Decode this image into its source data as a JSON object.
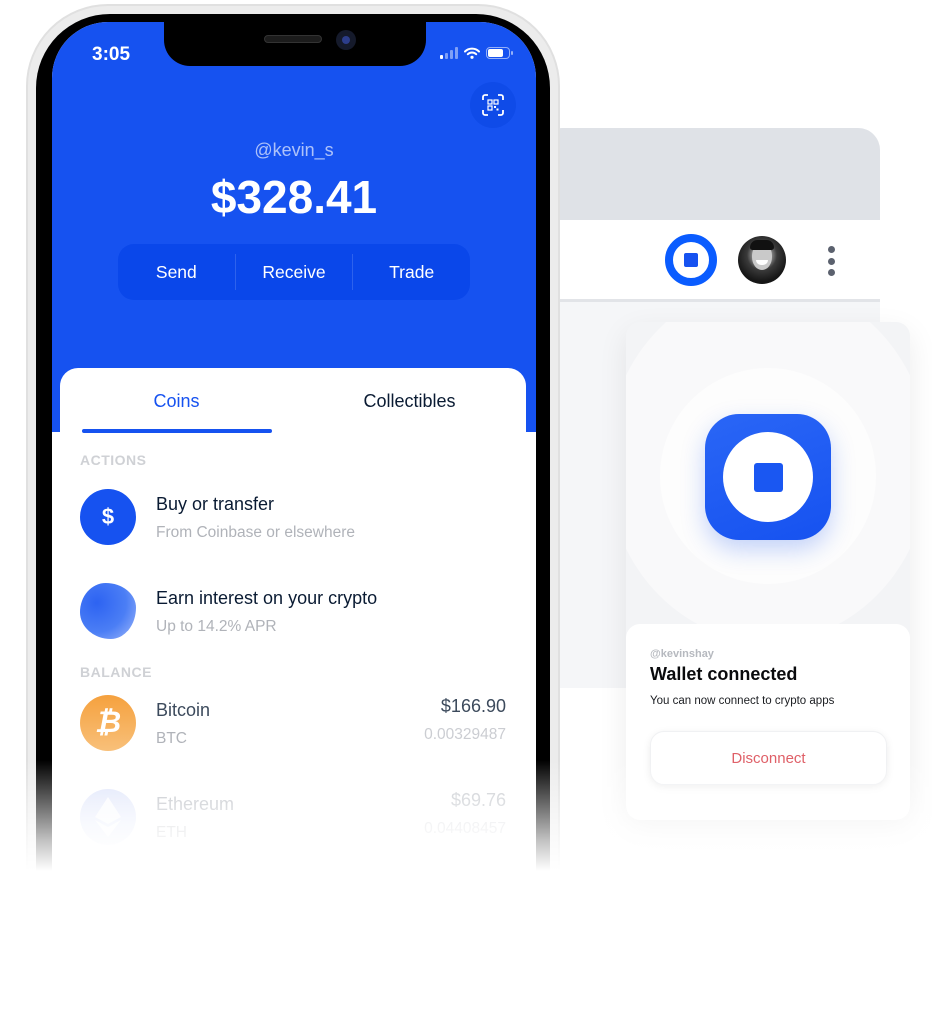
{
  "browser": {
    "extension_icon": "coinbase-wallet-icon",
    "avatar": "user-avatar",
    "menu_icon": "kebab-menu-icon"
  },
  "popup": {
    "logo": "coinbase-wallet-logo",
    "username": "@kevinshay",
    "title": "Wallet connected",
    "subtitle": "You can now connect to crypto apps",
    "disconnect_label": "Disconnect",
    "colors": {
      "brand": "#1652f0",
      "danger": "#df5f67"
    }
  },
  "phone": {
    "status_bar": {
      "time": "3:05",
      "signal_bars": 1,
      "signal_max": 4,
      "battery_level": 0.75
    },
    "header": {
      "qr_icon": "qr-scan-icon",
      "username": "@kevin_s",
      "balance": "$328.41",
      "actions": [
        "Send",
        "Receive",
        "Trade"
      ]
    },
    "tabs": [
      {
        "label": "Coins",
        "active": true
      },
      {
        "label": "Collectibles",
        "active": false
      }
    ],
    "sections": {
      "actions_label": "ACTIONS",
      "balance_label": "BALANCE"
    },
    "action_items": [
      {
        "icon": "dollar-icon",
        "glyph": "$",
        "title": "Buy or transfer",
        "subtitle": "From Coinbase or elsewhere"
      },
      {
        "icon": "earn-blob-icon",
        "title": "Earn interest on your crypto",
        "subtitle": "Up to 14.2% APR"
      }
    ],
    "assets": [
      {
        "icon": "bitcoin-icon",
        "glyph": "₿",
        "name": "Bitcoin",
        "symbol": "BTC",
        "value": "$166.90",
        "amount": "0.00329487"
      },
      {
        "icon": "ethereum-icon",
        "name": "Ethereum",
        "symbol": "ETH",
        "value": "$69.76",
        "amount": "0.04408457"
      }
    ],
    "colors": {
      "brand": "#1652f0",
      "bitcoin": "#f5a13e"
    }
  }
}
